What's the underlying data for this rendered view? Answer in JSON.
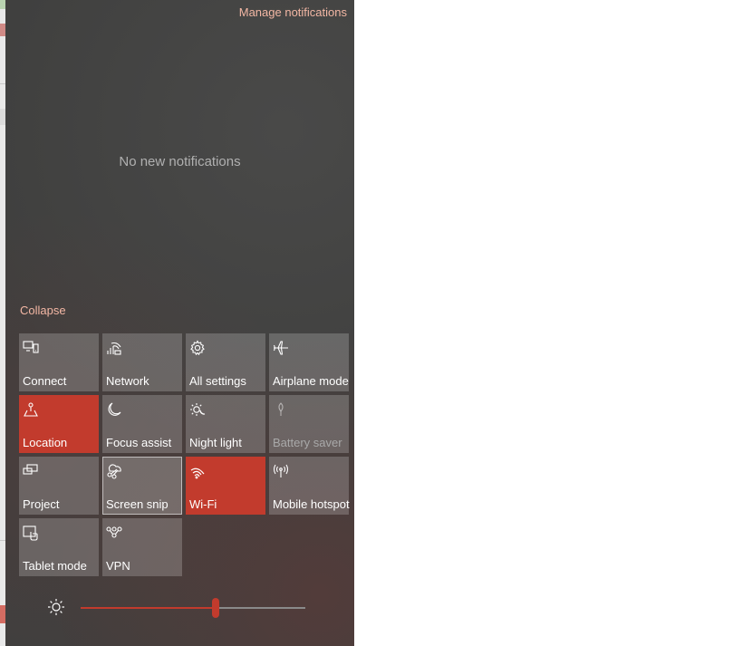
{
  "header": {
    "manage_label": "Manage notifications"
  },
  "notifications": {
    "empty_message": "No new notifications"
  },
  "collapse_label": "Collapse",
  "tiles": [
    {
      "label": "Connect",
      "icon": "connect-icon",
      "state": "off"
    },
    {
      "label": "Network",
      "icon": "network-icon",
      "state": "off"
    },
    {
      "label": "All settings",
      "icon": "gear-icon",
      "state": "off"
    },
    {
      "label": "Airplane mode",
      "icon": "airplane-icon",
      "state": "off"
    },
    {
      "label": "Location",
      "icon": "location-icon",
      "state": "on"
    },
    {
      "label": "Focus assist",
      "icon": "moon-icon",
      "state": "off"
    },
    {
      "label": "Night light",
      "icon": "night-light-icon",
      "state": "off"
    },
    {
      "label": "Battery saver",
      "icon": "battery-saver-icon",
      "state": "disabled"
    },
    {
      "label": "Project",
      "icon": "project-icon",
      "state": "off"
    },
    {
      "label": "Screen snip",
      "icon": "screen-snip-icon",
      "state": "focused"
    },
    {
      "label": "Wi-Fi",
      "icon": "wifi-icon",
      "state": "on"
    },
    {
      "label": "Mobile hotspot",
      "icon": "hotspot-icon",
      "state": "off"
    },
    {
      "label": "Tablet mode",
      "icon": "tablet-mode-icon",
      "state": "off"
    },
    {
      "label": "VPN",
      "icon": "vpn-icon",
      "state": "off"
    }
  ],
  "brightness": {
    "value_fraction": 0.6,
    "icon": "sun-icon"
  },
  "colors": {
    "accent": "#c23b2d",
    "link": "#f3b7a4",
    "panel": "#3f3f3e",
    "tile": "#5a5a59"
  }
}
